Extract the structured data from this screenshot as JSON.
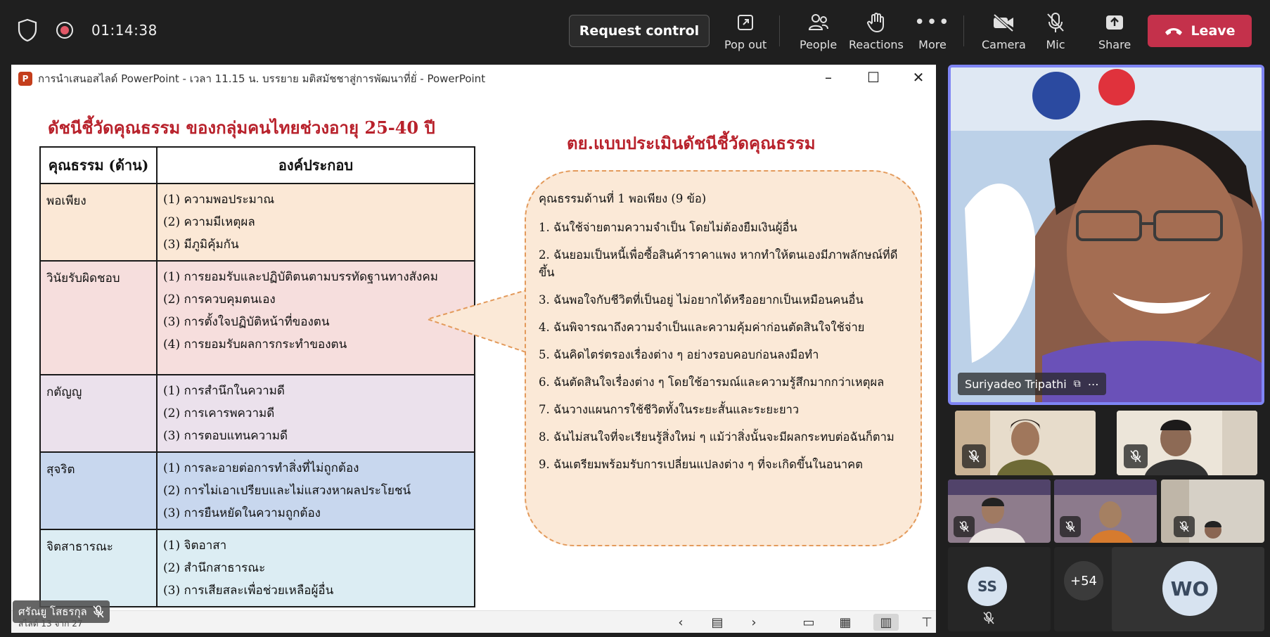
{
  "meeting": {
    "timer": "01:14:38",
    "request_control": "Request control",
    "buttons": {
      "popout": "Pop out",
      "people": "People",
      "reactions": "Reactions",
      "more": "More",
      "camera": "Camera",
      "mic": "Mic",
      "share": "Share",
      "leave": "Leave"
    },
    "leave_color": "#c4314b"
  },
  "window": {
    "title": "การนำเสนอสไลด์ PowerPoint  -  เวลา 11.15 น. บรรยาย มติสมัชชาสู่การพัฒนาที่ยั่ - PowerPoint",
    "app_badge": "P"
  },
  "slide": {
    "title": "ดัชนีชี้วัดคุณธรรม ของกลุ่มคนไทยช่วงอายุ 25-40 ปี",
    "example_title": "ตย.แบบประเมินดัชนีชี้วัดคุณธรรม",
    "table": {
      "headers": [
        "คุณธรรม (ด้าน)",
        "องค์ประกอบ"
      ],
      "rows": [
        {
          "category": "พอเพียง",
          "color": "#fbe8d6",
          "items": [
            "(1) ความพอประมาณ",
            "(2) ความมีเหตุผล",
            "(3) มีภูมิคุ้มกัน"
          ]
        },
        {
          "category": "วินัยรับผิดชอบ",
          "color": "#f6dedd",
          "items": [
            "(1) การยอมรับและปฏิบัติตนตามบรรทัดฐานทางสังคม",
            "(2) การควบคุมตนเอง",
            "(3) การตั้งใจปฏิบัติหน้าที่ของตน",
            "(4) การยอมรับผลการกระทำของตน"
          ]
        },
        {
          "category": "กตัญญู",
          "color": "#ebe1ec",
          "items": [
            "(1) การสำนึกในความดี",
            "(2) การเคารพความดี",
            "(3) การตอบแทนความดี"
          ]
        },
        {
          "category": "สุจริต",
          "color": "#c8d7ee",
          "items": [
            "(1) การละอายต่อการทำสิ่งที่ไม่ถูกต้อง",
            "(2) การไม่เอาเปรียบและไม่แสวงหาผลประโยชน์",
            "(3) การยืนหยัดในความถูกต้อง"
          ]
        },
        {
          "category": "จิตสาธารณะ",
          "color": "#dcedf3",
          "items": [
            "(1) จิตอาสา",
            "(2) สำนึกสาธารณะ",
            "(3) การเสียสละเพื่อช่วยเหลือผู้อื่น"
          ]
        }
      ]
    },
    "questionnaire": {
      "heading": "คุณธรรมด้านที่ 1 พอเพียง (9 ข้อ)",
      "questions": [
        "1. ฉันใช้จ่ายตามความจำเป็น โดยไม่ต้องยืมเงินผู้อื่น",
        "2. ฉันยอมเป็นหนี้เพื่อซื้อสินค้าราคาแพง หากทำให้ตนเองมีภาพลักษณ์ที่ดีขึ้น",
        "3. ฉันพอใจกับชีวิตที่เป็นอยู่ ไม่อยากได้หรืออยากเป็นเหมือนคนอื่น",
        "4. ฉันพิจารณาถึงความจำเป็นและความคุ้มค่าก่อนตัดสินใจใช้จ่าย",
        "5. ฉันคิดไตร่ตรองเรื่องต่าง ๆ อย่างรอบคอบก่อนลงมือทำ",
        "6. ฉันตัดสินใจเรื่องต่าง ๆ โดยใช้อารมณ์และความรู้สึกมากกว่าเหตุผล",
        "7. ฉันวางแผนการใช้ชีวิตทั้งในระยะสั้นและระยะยาว",
        "8. ฉันไม่สนใจที่จะเรียนรู้สิ่งใหม่ ๆ แม้ว่าสิ่งนั้นจะมีผลกระทบต่อฉันก็ตาม",
        "9. ฉันเตรียมพร้อมรับการเปลี่ยนแปลงต่าง ๆ ที่จะเกิดขึ้นในอนาคต"
      ]
    },
    "status": "สไลด์ 13 จาก 27",
    "presenter": "ศรัณยู โสธรกุล"
  },
  "participants": {
    "main_speaker": "Suriyadeo Tripathi",
    "overflow_count": "+54",
    "avatars": [
      "SS",
      "WO"
    ],
    "accent": "#7f85f5"
  }
}
